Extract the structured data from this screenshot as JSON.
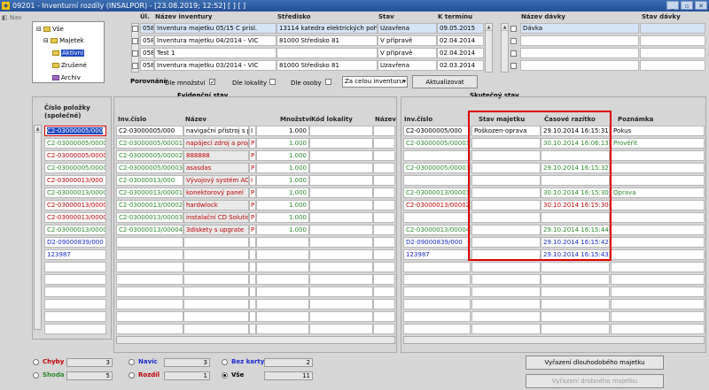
{
  "window": {
    "title": "09201 - Inventurní rozdíly (INSALPOR) - [23.08.2019; 12:52]  [ ]  [ ]",
    "app_icon": "app-logo-icon"
  },
  "nav_label": "Nav",
  "tree": {
    "root": "Vše",
    "child": "Majetek",
    "items": [
      "Aktivní",
      "Zrušené",
      "Archiv"
    ]
  },
  "inventory_headers": {
    "ul": "Úl.",
    "nazev": "Název inventury",
    "stredisko": "Středisko",
    "stav": "Stav",
    "termin": "K termínu"
  },
  "inventory_rows": [
    {
      "ul": "058",
      "nazev": "Inventura majetku 05/15 C prisl.",
      "stredisko": "13114 katedra elektrických pohonů",
      "stav": "Uzavřena",
      "termin": "09.05.2015"
    },
    {
      "ul": "058",
      "nazev": "Inventura majetku 04/2014 - VIC",
      "stredisko": "81000 Středisko 81",
      "stav": "V přípravě",
      "termin": "02.04.2014"
    },
    {
      "ul": "058",
      "nazev": "Test 1",
      "stredisko": "",
      "stav": "V přípravě",
      "termin": "02.04.2014"
    },
    {
      "ul": "058",
      "nazev": "Inventura majetku 03/2014 - VIC",
      "stredisko": "81000 Středisko 81",
      "stav": "Uzavřena",
      "termin": "02.03.2014"
    }
  ],
  "davka_headers": {
    "nazev": "Název dávky",
    "stav": "Stav dávky"
  },
  "davka_rows": [
    "Dávka",
    "",
    "",
    ""
  ],
  "porovnani": {
    "label": "Porovnání:",
    "dle_mnozstvi": "Dle množství",
    "dle_lokality": "Dle lokality",
    "dle_osoby": "Dle osoby",
    "select_value": "Za celou inventuru",
    "aktualizovat": "Aktualizovat"
  },
  "section_evid": "Evidenční stav",
  "section_skut": "Skutečný stav",
  "cislo_polozky_header": "Číslo položky (společné)",
  "cislo_rows": [
    {
      "v": "C2-03000005/000",
      "c": "sel"
    },
    {
      "v": "C2-03000005/00001",
      "c": "green"
    },
    {
      "v": "C2-03000005/00002",
      "c": "red"
    },
    {
      "v": "C2-03000005/00003",
      "c": "green"
    },
    {
      "v": "C2-03000013/000",
      "c": "red"
    },
    {
      "v": "C2-03000013/00001",
      "c": "green"
    },
    {
      "v": "C2-03000013/00002",
      "c": "red"
    },
    {
      "v": "C2-03000013/00003",
      "c": "red"
    },
    {
      "v": "C2-03000013/00004",
      "c": "green"
    },
    {
      "v": "D2-09000839/000",
      "c": "blue"
    },
    {
      "v": "123987",
      "c": "blue"
    }
  ],
  "evid_headers": {
    "inv": "Inv.číslo",
    "nazev": "Název",
    "mnozstvi": "Množství",
    "kod": "Kód lokality",
    "nazev2": "Název"
  },
  "evid_rows": [
    {
      "inv": "C2-03000005/000",
      "nazev": "navigační přístroj s při",
      "flag": "I",
      "mn": "1.000",
      "c": "black"
    },
    {
      "inv": "C2-03000005/00001",
      "nazev": "napájecí zdroj a propo",
      "flag": "P",
      "mn": "1.000",
      "c": "red"
    },
    {
      "inv": "C2-03000005/00002",
      "nazev": "888888",
      "flag": "P",
      "mn": "1.000",
      "c": "red"
    },
    {
      "inv": "C2-03000005/00003",
      "nazev": "asasdas",
      "flag": "P",
      "mn": "1.000",
      "c": "red"
    },
    {
      "inv": "C2-03000013/000",
      "nazev": "Vývojový systém ACE",
      "flag": "I",
      "mn": "1.000",
      "c": "red"
    },
    {
      "inv": "C2-03000013/00001",
      "nazev": "konektorový panel",
      "flag": "P",
      "mn": "1.000",
      "c": "red"
    },
    {
      "inv": "C2-03000013/00002",
      "nazev": "hardwlock",
      "flag": "P",
      "mn": "1.000",
      "c": "red"
    },
    {
      "inv": "C2-03000013/00003",
      "nazev": "instalační CD Solution",
      "flag": "P",
      "mn": "1.000",
      "c": "red"
    },
    {
      "inv": "C2-03000013/00004",
      "nazev": "3diskety s upgrate",
      "flag": "P",
      "mn": "1.000",
      "c": "red"
    }
  ],
  "skut_headers": {
    "inv": "Inv.číslo",
    "stav": "Stav majetku",
    "razitko": "Časové razítko",
    "poznamka": "Poznámka"
  },
  "skut_rows": [
    {
      "inv": "C2-03000005/000",
      "stav": "Poškozen-oprava",
      "raz": "29.10.2014 16:15:31",
      "poz": "Pokus",
      "c": "black"
    },
    {
      "inv": "C2-03000005/00001",
      "stav": "",
      "raz": "30.10.2014 16:06:13",
      "poz": "Prověřit",
      "c": "green"
    },
    {
      "inv": "",
      "stav": "",
      "raz": "",
      "poz": "",
      "c": "black"
    },
    {
      "inv": "C2-03000005/00003",
      "stav": "",
      "raz": "29.10.2014 16:15:32",
      "poz": "",
      "c": "green"
    },
    {
      "inv": "",
      "stav": "",
      "raz": "",
      "poz": "",
      "c": "black"
    },
    {
      "inv": "C2-03000013/00001",
      "stav": "",
      "raz": "30.10.2014 16:15:30",
      "poz": "Oprava",
      "c": "green"
    },
    {
      "inv": "C2-03000013/00002",
      "stav": "",
      "raz": "30.10.2014 16:15:30",
      "poz": "",
      "c": "red"
    },
    {
      "inv": "",
      "stav": "",
      "raz": "",
      "poz": "",
      "c": "black"
    },
    {
      "inv": "C2-03000013/00004",
      "stav": "",
      "raz": "29.10.2014 16:15:44",
      "poz": "",
      "c": "green"
    },
    {
      "inv": "D2-09000839/000",
      "stav": "",
      "raz": "29.10.2014 16:15:42",
      "poz": "",
      "c": "blue"
    },
    {
      "inv": "123987",
      "stav": "",
      "raz": "29.10.2014 16:15:43",
      "poz": "",
      "c": "blue"
    }
  ],
  "legend": {
    "chyby": {
      "label": "Chyby",
      "count": "3"
    },
    "shoda": {
      "label": "Shoda",
      "count": "5"
    },
    "navic": {
      "label": "Navíc",
      "count": "3"
    },
    "rozdil": {
      "label": "Rozdíl",
      "count": "1"
    },
    "bez_karty": {
      "label": "Bez karty",
      "count": "2"
    },
    "vse": {
      "label": "Vše",
      "count": "11"
    }
  },
  "buttons": {
    "vyrazeni_dlouho": "Vyřazení dlouhodobého majetku",
    "vyrazeni_drobne": "Vyřazení drobného majetku"
  },
  "colors": {
    "green": "#2a8a2a",
    "red": "#c00000",
    "blue": "#1a2ad0",
    "highlight": "#e00000",
    "title_bar": "#245094"
  }
}
